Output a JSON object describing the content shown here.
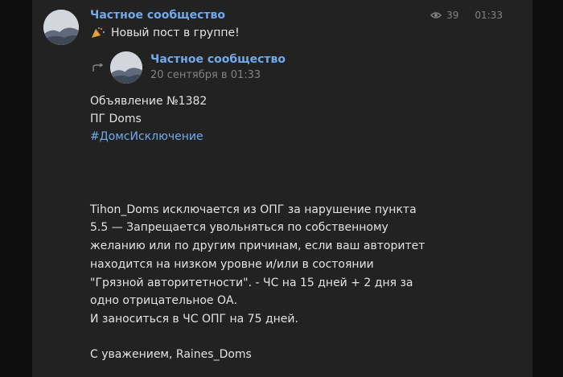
{
  "post": {
    "author": "Частное сообщество",
    "views": "39",
    "time": "01:33",
    "subtitle": "Новый пост в группе!"
  },
  "repost": {
    "author": "Частное сообщество",
    "date": "20 сентября в 01:33",
    "lines": [
      "Объявление №1382",
      "ПГ Doms"
    ],
    "hashtag": "#ДомсИсключение",
    "body": [
      "Tihon_Doms исключается из ОПГ за нарушение пункта",
      "5.5 — Запрещается увольняться по собственному",
      "желанию или по другим причинам, если ваш авторитет",
      "находится на низком уровне и/или в состоянии",
      "\"Грязной авторитетности\". - ЧС на 15 дней + 2 дня за",
      "одно отрицательное ОА.",
      "И заноситься в ЧС ОПГ на 75 дней."
    ],
    "signature": "С уважением, Raines_Doms"
  },
  "colors": {
    "link": "#71aaeb",
    "text": "#e1e3e6",
    "muted": "#828282",
    "panel": "#222222",
    "background": "#0e0e0e"
  },
  "icons": [
    "avatar-landscape-icon",
    "eye-icon",
    "party-emoji-icon",
    "repost-arrow-icon"
  ]
}
